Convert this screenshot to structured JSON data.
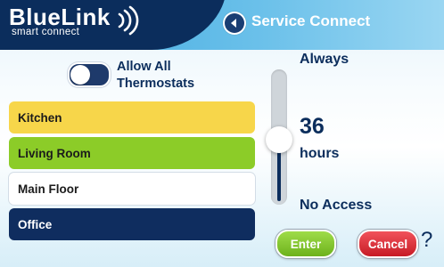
{
  "header": {
    "logo_main": "BlueLink",
    "logo_sub": "smart connect",
    "title": "Service Connect"
  },
  "toggle": {
    "label": "Allow All Thermostats",
    "on": false
  },
  "thermostats": [
    {
      "name": "Kitchen",
      "color": "#f7d64a"
    },
    {
      "name": "Living Room",
      "color": "#8ccc28"
    },
    {
      "name": "Main Floor",
      "color": "#ffffff"
    },
    {
      "name": "Office",
      "color": "#0f2d5f"
    }
  ],
  "slider": {
    "top_label": "Always",
    "value": "36",
    "unit": "hours",
    "bottom_label": "No Access"
  },
  "buttons": {
    "enter": "Enter",
    "cancel": "Cancel",
    "help": "?"
  },
  "colors": {
    "navy": "#0b2d5c",
    "header_blue": "#3aa6de",
    "enter_green": "#6db21c",
    "cancel_red": "#c71b25"
  }
}
